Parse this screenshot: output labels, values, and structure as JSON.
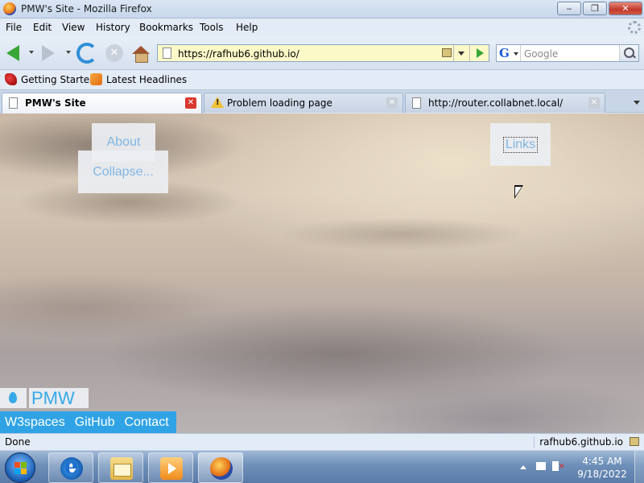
{
  "window": {
    "title": "PMW's Site - Mozilla Firefox",
    "controls": {
      "minimize": "‒",
      "maximize": "❐",
      "close": "✕"
    }
  },
  "menu": [
    "File",
    "Edit",
    "View",
    "History",
    "Bookmarks",
    "Tools",
    "Help"
  ],
  "navigation": {
    "url": "https://rafhub6.github.io/",
    "search_engine": "G",
    "search_placeholder": "Google"
  },
  "bookmarks": [
    {
      "label": "Getting Started",
      "icon": "firefox-bookmark-icon"
    },
    {
      "label": "Latest Headlines",
      "icon": "rss-icon"
    }
  ],
  "tabs": [
    {
      "label": "PMW's Site",
      "active": true,
      "icon": "page-icon"
    },
    {
      "label": "Problem loading page",
      "active": false,
      "icon": "warning-icon"
    },
    {
      "label": "http://router.collabnet.local/",
      "active": false,
      "icon": "page-icon"
    }
  ],
  "tab_close_glyph": "✕",
  "page": {
    "about": "About",
    "collapse": "Collapse...",
    "links": "Links",
    "logo_text": "PMW",
    "footer_links": [
      "W3spaces",
      "GitHub",
      "Contact"
    ]
  },
  "status": {
    "text": "Done",
    "host": "rafhub6.github.io"
  },
  "taskbar": {
    "apps": [
      "internet-explorer",
      "windows-explorer",
      "media-player",
      "firefox"
    ],
    "clock_time": "4:45 AM",
    "clock_date": "9/18/2022"
  },
  "colors": {
    "accent": "#2fa3e6",
    "page_link": "#7fb6e4"
  }
}
